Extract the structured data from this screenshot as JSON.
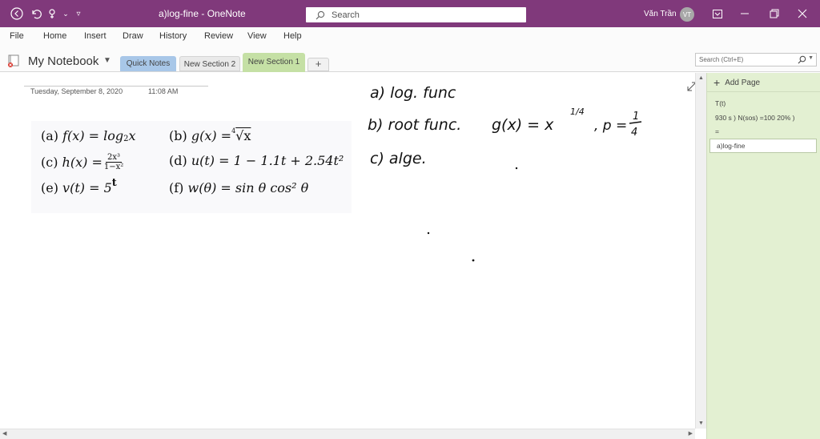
{
  "window": {
    "title": "a)log-fine - OneNote",
    "search_placeholder": "Search",
    "user_name": "Văn Trần",
    "user_initials": "VT",
    "accent_color": "#80397b"
  },
  "menu": [
    "File",
    "Home",
    "Insert",
    "Draw",
    "History",
    "Review",
    "View",
    "Help"
  ],
  "notebook": {
    "name": "My Notebook",
    "sections": [
      {
        "label": "Quick Notes",
        "color": "#a8c7e8"
      },
      {
        "label": "New Section 2",
        "color": "#e8e8e8"
      },
      {
        "label": "New Section 1",
        "color": "#c5e0a5"
      }
    ],
    "add_section_label": "+",
    "search_pages_placeholder": "Search (Ctrl+E)"
  },
  "page": {
    "date": "Tuesday, September 8, 2020",
    "time": "11:08 AM",
    "problems": {
      "a_label": "(a)",
      "a_lhs": "f(x) = log",
      "a_sub": "2",
      "a_rhs": " x",
      "b_label": "(b)",
      "b_lhs": "g(x) = ",
      "b_index": "4",
      "b_rad": "√x",
      "c_label": "(c)",
      "c_lhs": "h(x) =",
      "c_num": "2x³",
      "c_den": "1−x²",
      "d_label": "(d)",
      "d_expr": "u(t) = 1 − 1.1t + 2.54t²",
      "e_label": "(e)",
      "e_expr": "v(t) = 5",
      "e_sup": "t",
      "f_label": "(f)",
      "f_expr": "w(θ) = sin θ cos² θ"
    },
    "handwriting": {
      "line_a": "a) log. func",
      "line_b": "b) root func.",
      "line_b_eq": "g(x) = x",
      "line_b_exp": "1/4",
      "line_b_p": ", p =",
      "line_b_p_num": "1",
      "line_b_p_den": "4",
      "line_c": "c) alge."
    }
  },
  "pages_panel": {
    "add_page_label": "Add Page",
    "pages": [
      "T(t)",
      "930 s ) N(sos) =100  20% )",
      "=",
      "a)log-fine"
    ],
    "selected_index": 3,
    "panel_color": "#e3f0d2"
  }
}
